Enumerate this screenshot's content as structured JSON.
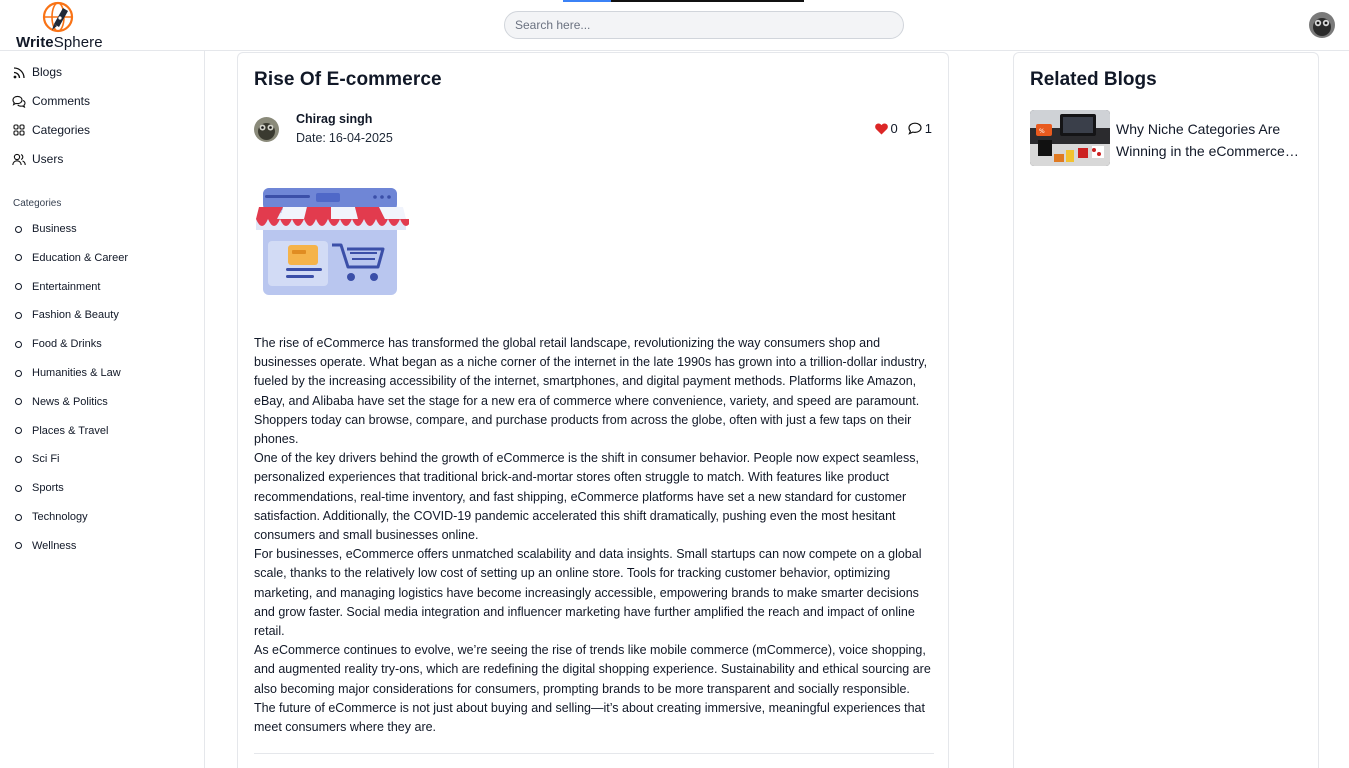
{
  "header": {
    "brand_bold": "Write",
    "brand_light": "Sphere",
    "search_placeholder": "Search here...",
    "scroll_progress_fraction": 0.2,
    "accent_color": "#3b82f6",
    "logo_color": "#f97316"
  },
  "sidebar": {
    "nav": [
      {
        "label": "Blogs",
        "icon": "rss-icon"
      },
      {
        "label": "Comments",
        "icon": "comments-icon"
      },
      {
        "label": "Categories",
        "icon": "grid-icon"
      },
      {
        "label": "Users",
        "icon": "users-icon"
      }
    ],
    "categories_heading": "Categories",
    "categories": [
      "Business",
      "Education & Career",
      "Entertainment",
      "Fashion & Beauty",
      "Food & Drinks",
      "Humanities & Law",
      "News & Politics",
      "Places & Travel",
      "Sci Fi",
      "Sports",
      "Technology",
      "Wellness"
    ]
  },
  "post": {
    "title": "Rise Of E-commerce",
    "author": "Chirag singh",
    "date_label": "Date:",
    "date": "16-04-2025",
    "likes": "0",
    "comments": "1",
    "image_icon": "shop-storefront-icon",
    "paragraphs": [
      "The rise of eCommerce has transformed the global retail landscape, revolutionizing the way consumers shop and businesses operate. What began as a niche corner of the internet in the late 1990s has grown into a trillion-dollar industry, fueled by the increasing accessibility of the internet, smartphones, and digital payment methods. Platforms like Amazon, eBay, and Alibaba have set the stage for a new era of commerce where convenience, variety, and speed are paramount. Shoppers today can browse, compare, and purchase products from across the globe, often with just a few taps on their phones.",
      "One of the key drivers behind the growth of eCommerce is the shift in consumer behavior. People now expect seamless, personalized experiences that traditional brick-and-mortar stores often struggle to match. With features like product recommendations, real-time inventory, and fast shipping, eCommerce platforms have set a new standard for customer satisfaction. Additionally, the COVID-19 pandemic accelerated this shift dramatically, pushing even the most hesitant consumers and small businesses online.",
      "For businesses, eCommerce offers unmatched scalability and data insights. Small startups can now compete on a global scale, thanks to the relatively low cost of setting up an online store. Tools for tracking customer behavior, optimizing marketing, and managing logistics have become increasingly accessible, empowering brands to make smarter decisions and grow faster. Social media integration and influencer marketing have further amplified the reach and impact of online retail.",
      "As eCommerce continues to evolve, we’re seeing the rise of trends like mobile commerce (mCommerce), voice shopping, and augmented reality try-ons, which are redefining the digital shopping experience. Sustainability and ethical sourcing are also becoming major considerations for consumers, prompting brands to be more transparent and socially responsible. The future of eCommerce is not just about buying and selling—it’s about creating immersive, meaningful experiences that meet consumers where they are."
    ]
  },
  "related": {
    "title": "Related Blogs",
    "items": [
      {
        "title": "Why Niche Categories Are Winning in the eCommerce Space"
      }
    ]
  }
}
